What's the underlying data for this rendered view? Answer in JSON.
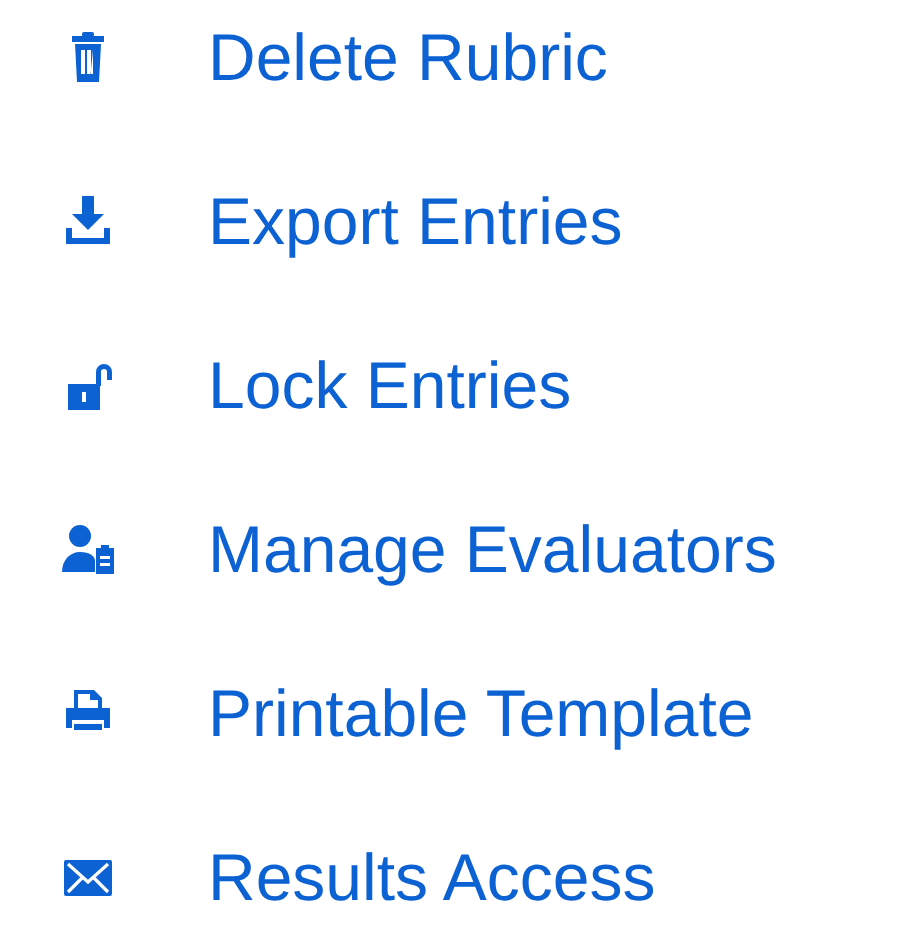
{
  "menu": {
    "items": [
      {
        "label": "Delete Rubric"
      },
      {
        "label": "Export Entries"
      },
      {
        "label": "Lock Entries"
      },
      {
        "label": "Manage Evaluators"
      },
      {
        "label": "Printable Template"
      },
      {
        "label": "Results Access"
      }
    ]
  }
}
